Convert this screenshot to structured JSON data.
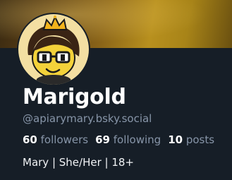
{
  "profile": {
    "display_name": "Marigold",
    "handle": "@apiarymary.bsky.social",
    "bio": "Mary | She/Her | 18+"
  },
  "stats": {
    "followers_count": "60",
    "followers_label": "followers",
    "following_count": "69",
    "following_label": "following",
    "posts_count": "10",
    "posts_label": "posts"
  },
  "colors": {
    "background": "#161e27",
    "text_primary": "#ffffff",
    "text_secondary": "#8795a8",
    "banner_gold": "#b8901e"
  },
  "icons": {
    "avatar": "avatar-bee-character-with-crown-and-glasses"
  }
}
